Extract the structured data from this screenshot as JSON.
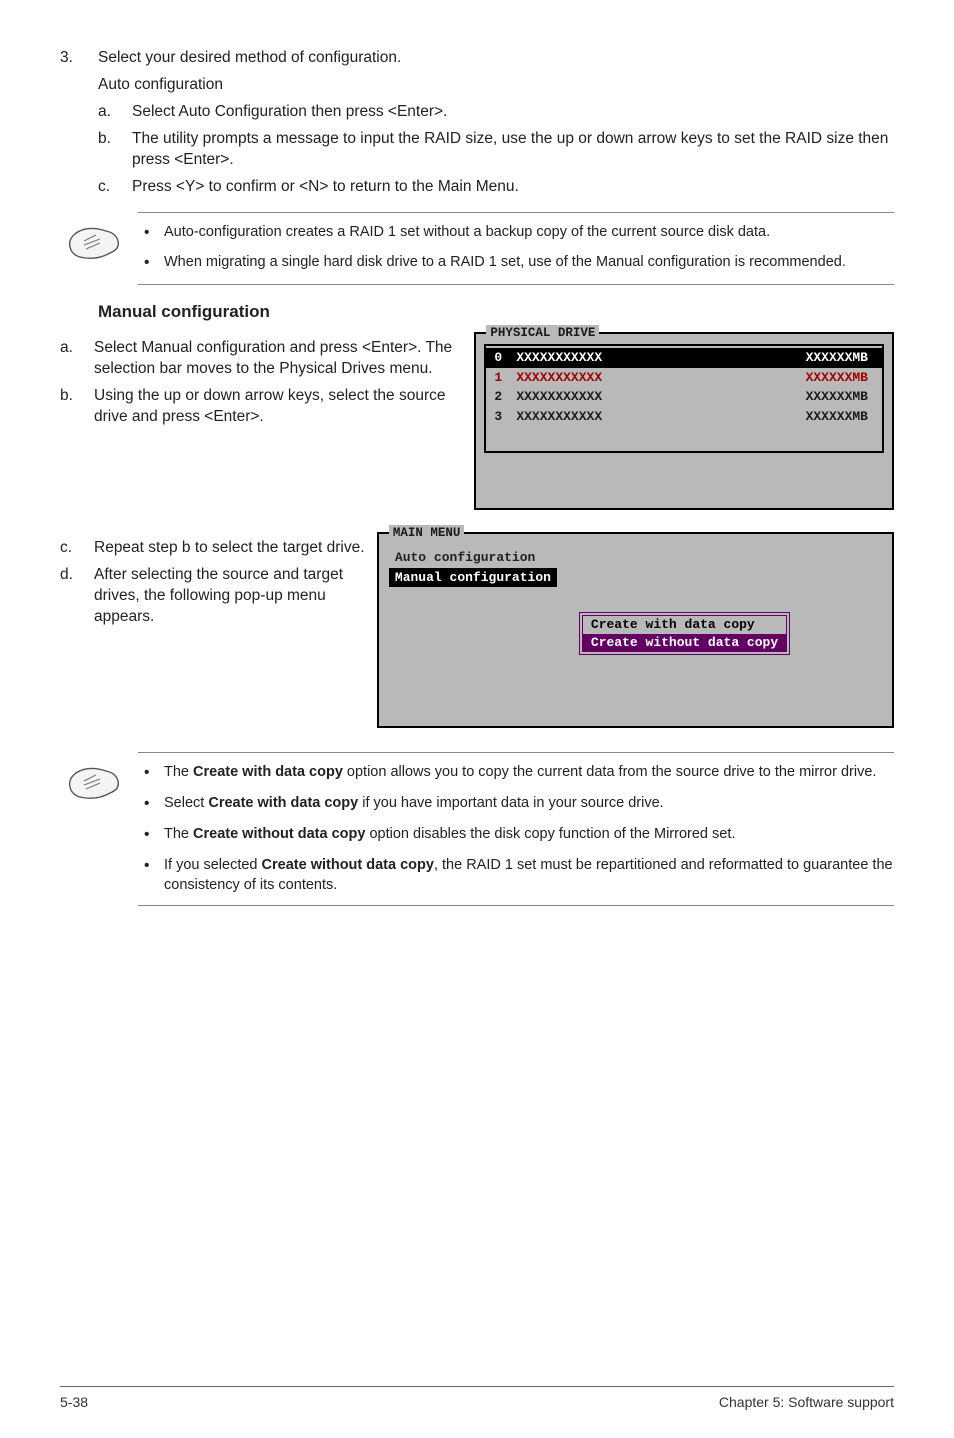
{
  "step3": {
    "num": "3.",
    "text": "Select your desired method of configuration.",
    "auto_title": "Auto configuration",
    "items": [
      {
        "letter": "a.",
        "text": "Select Auto Configuration then press <Enter>."
      },
      {
        "letter": "b.",
        "text": "The utility prompts a message to input the RAID size, use the up or down arrow keys to set the RAID size then press <Enter>."
      },
      {
        "letter": "c.",
        "text": "Press <Y> to confirm or <N> to return to the Main Menu."
      }
    ]
  },
  "note1": [
    "Auto-configuration creates a RAID 1 set without a backup copy of the current source disk data.",
    "When migrating a single hard disk drive to a RAID 1 set, use of the Manual configuration is recommended."
  ],
  "manual": {
    "heading": "Manual configuration",
    "a": {
      "letter": "a.",
      "text": "Select  Manual configuration and press <Enter>. The selection bar moves to the Physical Drives menu."
    },
    "b": {
      "letter": "b.",
      "text": "Using the up or down arrow keys, select the source drive and press <Enter>."
    },
    "c": {
      "letter": "c.",
      "text": "Repeat step b to select the target drive."
    },
    "d": {
      "letter": "d.",
      "text": "After selecting the source and target drives, the following pop-up menu appears."
    }
  },
  "phys": {
    "title": "PHYSICAL DRIVE",
    "rows": [
      {
        "idx": "0",
        "name": "XXXXXXXXXXX",
        "size": "XXXXXXMB",
        "cls": "sel"
      },
      {
        "idx": "1",
        "name": "XXXXXXXXXXX",
        "size": "XXXXXXMB",
        "cls": "red"
      },
      {
        "idx": "2",
        "name": "XXXXXXXXXXX",
        "size": "XXXXXXMB",
        "cls": ""
      },
      {
        "idx": "3",
        "name": "XXXXXXXXXXX",
        "size": "XXXXXXMB",
        "cls": ""
      }
    ]
  },
  "mainmenu": {
    "title": "MAIN MENU",
    "line1": "Auto configuration",
    "line2": "Manual configuration",
    "popup1": " Create with data copy ",
    "popup2": "Create without data copy"
  },
  "note2": {
    "b1_bold": "Create with data copy",
    "b1_pre": "The ",
    "b1_post": " option allows you to copy the current data from the source drive to the mirror drive.",
    "b2_pre": "Select ",
    "b2_bold": "Create with data copy",
    "b2_post": " if you have important data in your source drive.",
    "b3_pre": "The ",
    "b3_bold": "Create without data copy",
    "b3_post": " option disables the disk copy function of the Mirrored set.",
    "b4_pre": "If you selected ",
    "b4_bold": "Create without data copy",
    "b4_post": ", the RAID 1 set must be repartitioned and reformatted to guarantee the consistency of its contents."
  },
  "footer": {
    "left": "5-38",
    "right": "Chapter 5: Software support"
  }
}
